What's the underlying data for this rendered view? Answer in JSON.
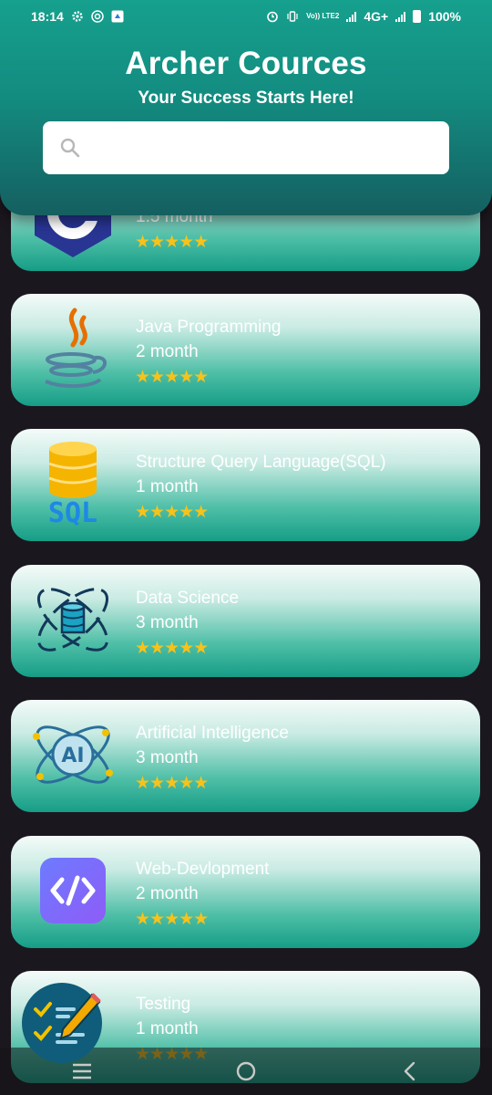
{
  "status": {
    "time": "18:14",
    "volte": "Vo)) LTE2",
    "network": "4G+",
    "battery": "100%"
  },
  "header": {
    "title": "Archer Cources",
    "subtitle": "Your Success Starts Here!",
    "search_placeholder": ""
  },
  "courses": [
    {
      "title": "",
      "duration": "1.5 month",
      "stars": "★★★★★",
      "icon": "c-language-icon"
    },
    {
      "title": "Java Programming",
      "duration": "2 month",
      "stars": "★★★★★",
      "icon": "java-icon"
    },
    {
      "title": "Structure Query Language(SQL)",
      "duration": "1 month",
      "stars": "★★★★★",
      "icon": "sql-icon"
    },
    {
      "title": "Data Science",
      "duration": "3 month",
      "stars": "★★★★★",
      "icon": "data-science-icon"
    },
    {
      "title": "Artificial Intelligence",
      "duration": "3 month",
      "stars": "★★★★★",
      "icon": "ai-icon"
    },
    {
      "title": "Web-Devlopment",
      "duration": "2 month",
      "stars": "★★★★★",
      "icon": "code-icon"
    },
    {
      "title": "Testing",
      "duration": "1 month",
      "stars": "★★★★★",
      "icon": "testing-icon"
    }
  ],
  "colors": {
    "accent": "#16a08e",
    "star": "#f7c21a",
    "background": "#1b171e"
  }
}
